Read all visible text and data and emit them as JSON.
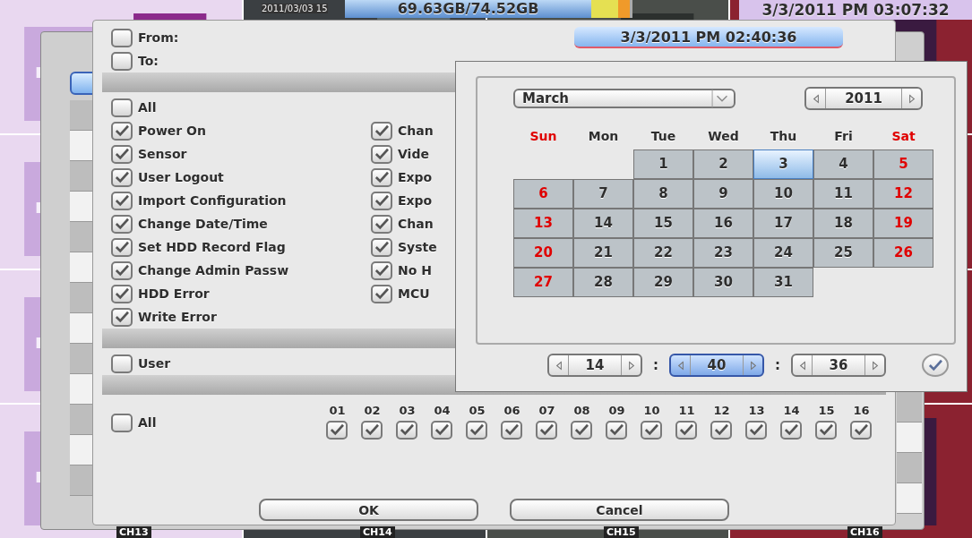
{
  "status_bar": {
    "tile_date": "2011/03/03 15",
    "storage": "69.63GB/74.52GB",
    "storage_meter": {
      "level": 0.93
    },
    "clock": "3/3/2011 PM 03:07:32"
  },
  "camera_labels": [
    "CH13",
    "CH14",
    "CH15",
    "CH16"
  ],
  "dialog": {
    "from": {
      "label": "From:",
      "checked": false
    },
    "to": {
      "label": "To:",
      "checked": false
    },
    "date_button": "3/3/2011 PM 02:40:36",
    "events_all": {
      "label": "All",
      "checked": false
    },
    "event_columns": [
      {
        "items": [
          {
            "label": "Power On",
            "checked": true
          },
          {
            "label": "Sensor",
            "checked": true
          },
          {
            "label": "User Logout",
            "checked": true
          },
          {
            "label": "Import Configuration",
            "checked": true
          },
          {
            "label": "Change Date/Time",
            "checked": true
          },
          {
            "label": "Set HDD Record Flag",
            "checked": true
          },
          {
            "label": "Change Admin Passw",
            "checked": true
          },
          {
            "label": "HDD Error",
            "checked": true
          },
          {
            "label": "Write Error",
            "checked": true
          }
        ]
      },
      {
        "items": [
          {
            "label": "Chan",
            "checked": true
          },
          {
            "label": "Vide",
            "checked": true
          },
          {
            "label": "Expo",
            "checked": true
          },
          {
            "label": "Expo",
            "checked": true
          },
          {
            "label": "Chan",
            "checked": true
          },
          {
            "label": "Syste",
            "checked": true
          },
          {
            "label": "No H",
            "checked": true
          },
          {
            "label": "MCU",
            "checked": true
          }
        ]
      }
    ],
    "user": {
      "label": "User",
      "checked": false
    },
    "channels_all": {
      "label": "All",
      "checked": false
    },
    "channels": [
      {
        "number": "01",
        "checked": true
      },
      {
        "number": "02",
        "checked": true
      },
      {
        "number": "03",
        "checked": true
      },
      {
        "number": "04",
        "checked": true
      },
      {
        "number": "05",
        "checked": true
      },
      {
        "number": "06",
        "checked": true
      },
      {
        "number": "07",
        "checked": true
      },
      {
        "number": "08",
        "checked": true
      },
      {
        "number": "09",
        "checked": true
      },
      {
        "number": "10",
        "checked": true
      },
      {
        "number": "11",
        "checked": true
      },
      {
        "number": "12",
        "checked": true
      },
      {
        "number": "13",
        "checked": true
      },
      {
        "number": "14",
        "checked": true
      },
      {
        "number": "15",
        "checked": true
      },
      {
        "number": "16",
        "checked": true
      }
    ],
    "buttons": [
      "OK",
      "Cancel"
    ]
  },
  "calendar": {
    "month": "March",
    "year": "2011",
    "weekdays": [
      {
        "label": "Sun",
        "weekend": true
      },
      {
        "label": "Mon",
        "weekend": false
      },
      {
        "label": "Tue",
        "weekend": false
      },
      {
        "label": "Wed",
        "weekend": false
      },
      {
        "label": "Thu",
        "weekend": false
      },
      {
        "label": "Fri",
        "weekend": false
      },
      {
        "label": "Sat",
        "weekend": true
      }
    ],
    "weeks": [
      [
        {
          "kind": "blank"
        },
        {
          "kind": "blank"
        },
        {
          "day": "1",
          "weekend": false,
          "selected": false
        },
        {
          "day": "2",
          "weekend": false,
          "selected": false
        },
        {
          "day": "3",
          "weekend": false,
          "selected": true
        },
        {
          "day": "4",
          "weekend": false,
          "selected": false
        },
        {
          "day": "5",
          "weekend": true,
          "selected": false
        }
      ],
      [
        {
          "day": "6",
          "weekend": true,
          "selected": false
        },
        {
          "day": "7",
          "weekend": false,
          "selected": false
        },
        {
          "day": "8",
          "weekend": false,
          "selected": false
        },
        {
          "day": "9",
          "weekend": false,
          "selected": false
        },
        {
          "day": "10",
          "weekend": false,
          "selected": false
        },
        {
          "day": "11",
          "weekend": false,
          "selected": false
        },
        {
          "day": "12",
          "weekend": true,
          "selected": false
        }
      ],
      [
        {
          "day": "13",
          "weekend": true,
          "selected": false
        },
        {
          "day": "14",
          "weekend": false,
          "selected": false
        },
        {
          "day": "15",
          "weekend": false,
          "selected": false
        },
        {
          "day": "16",
          "weekend": false,
          "selected": false
        },
        {
          "day": "17",
          "weekend": false,
          "selected": false
        },
        {
          "day": "18",
          "weekend": false,
          "selected": false
        },
        {
          "day": "19",
          "weekend": true,
          "selected": false
        }
      ],
      [
        {
          "day": "20",
          "weekend": true,
          "selected": false
        },
        {
          "day": "21",
          "weekend": false,
          "selected": false
        },
        {
          "day": "22",
          "weekend": false,
          "selected": false
        },
        {
          "day": "23",
          "weekend": false,
          "selected": false
        },
        {
          "day": "24",
          "weekend": false,
          "selected": false
        },
        {
          "day": "25",
          "weekend": false,
          "selected": false
        },
        {
          "day": "26",
          "weekend": true,
          "selected": false
        }
      ],
      [
        {
          "day": "27",
          "weekend": true,
          "selected": false
        },
        {
          "day": "28",
          "weekend": false,
          "selected": false
        },
        {
          "day": "29",
          "weekend": false,
          "selected": false
        },
        {
          "day": "30",
          "weekend": false,
          "selected": false
        },
        {
          "day": "31",
          "weekend": false,
          "selected": false
        },
        {
          "kind": "blank"
        },
        {
          "kind": "blank"
        }
      ]
    ],
    "time": [
      {
        "value": "14",
        "selected": false
      },
      {
        "value": "40",
        "selected": true
      },
      {
        "value": "36",
        "selected": false
      }
    ],
    "separators": [
      ":",
      ":"
    ]
  }
}
